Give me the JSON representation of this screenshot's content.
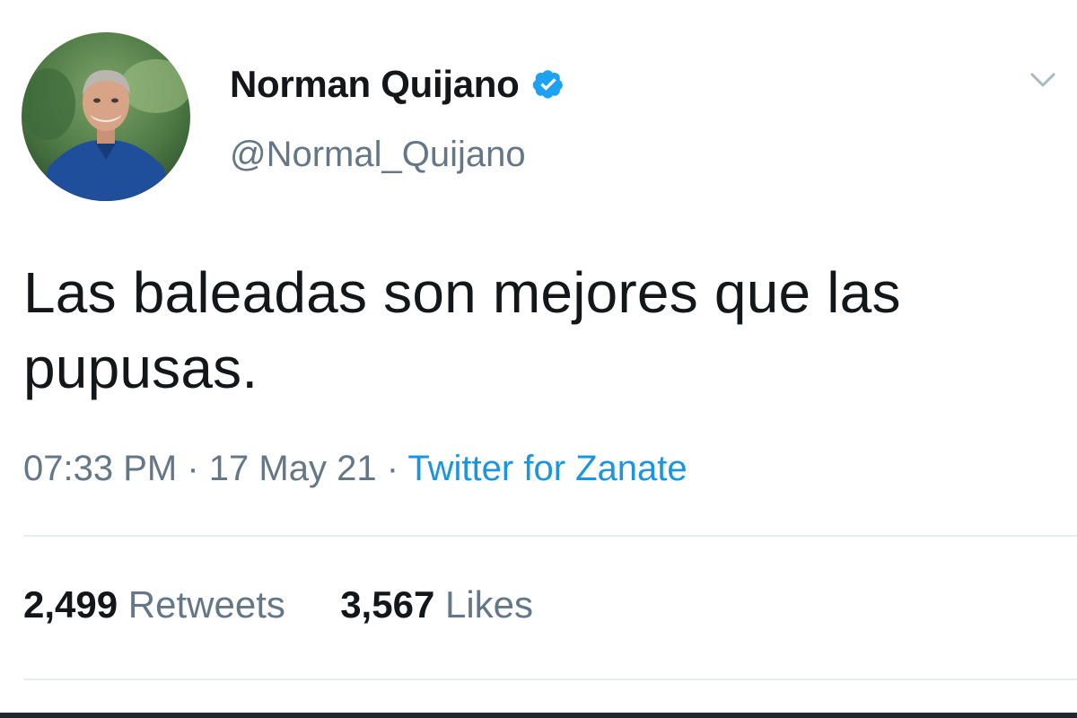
{
  "user": {
    "display_name": "Norman Quijano",
    "handle": "@Normal_Quijano",
    "verified_icon": "verified-badge-icon"
  },
  "tweet": {
    "text": "Las baleadas son mejores que las pupusas.",
    "time": "07:33 PM",
    "date": "17 May 21",
    "separator": "·",
    "source": "Twitter for Zanate"
  },
  "stats": {
    "retweets_count": "2,499",
    "retweets_label": "Retweets",
    "likes_count": "3,567",
    "likes_label": "Likes"
  },
  "colors": {
    "primary_text": "#14171a",
    "secondary_text": "#657786",
    "link": "#1b95e0",
    "verified": "#1da1f2",
    "divider": "#e6ecf0"
  }
}
